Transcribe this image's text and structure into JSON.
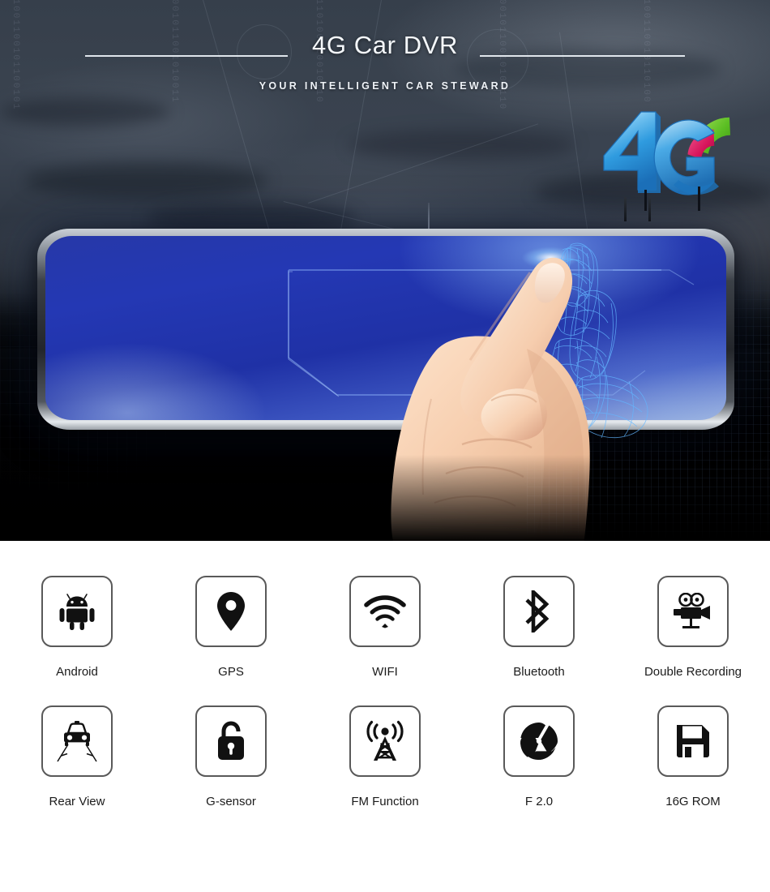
{
  "hero": {
    "title": "4G Car DVR",
    "subtitle": "YOUR INTELLIGENT CAR STEWARD",
    "logo_badge": "4G",
    "colors": {
      "sky_top": "#363f4b",
      "sky_bottom": "#05070a",
      "screen_blue": "#2438b4",
      "screen_highlight": "#9fb4df",
      "bezel_silver": "#c9cfd6",
      "logo_blue": "#2f9bdf",
      "logo_green": "#6ec72d",
      "logo_pink": "#d6145a",
      "accent_yellow": "#e9e030",
      "title_text": "#f4f7fa"
    },
    "binary_columns": [
      "01001100101100101",
      "1001011001010011",
      "0110100110010110",
      "10010110010100110",
      "0100110010110100"
    ]
  },
  "features": {
    "background": "#ffffff",
    "box_border": "#595959",
    "label_color": "#1b1b1b",
    "rows": [
      [
        {
          "icon": "android-icon",
          "label": "Android"
        },
        {
          "icon": "gps-pin-icon",
          "label": "GPS"
        },
        {
          "icon": "wifi-icon",
          "label": "WIFI"
        },
        {
          "icon": "bluetooth-icon",
          "label": "Bluetooth"
        },
        {
          "icon": "movie-camera-icon",
          "label": "Double Recording"
        }
      ],
      [
        {
          "icon": "rear-view-car-icon",
          "label": "Rear View"
        },
        {
          "icon": "padlock-icon",
          "label": "G-sensor"
        },
        {
          "icon": "radio-tower-icon",
          "label": "FM Function"
        },
        {
          "icon": "camera-aperture-icon",
          "label": "F 2.0"
        },
        {
          "icon": "floppy-disk-icon",
          "label": "16G ROM"
        }
      ]
    ]
  }
}
